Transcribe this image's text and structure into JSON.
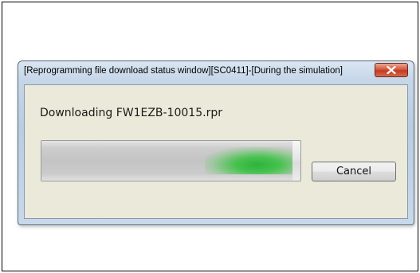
{
  "window": {
    "title": "[Reprogramming file download status window][SC0411]-[During the simulation]"
  },
  "status": {
    "message": "Downloading FW1EZB-10015.rpr"
  },
  "progress": {
    "fraction": 0.97
  },
  "buttons": {
    "cancel_label": "Cancel",
    "close_icon": "close-icon"
  },
  "colors": {
    "progress_green": "#2db33c",
    "close_red": "#c23b22"
  }
}
